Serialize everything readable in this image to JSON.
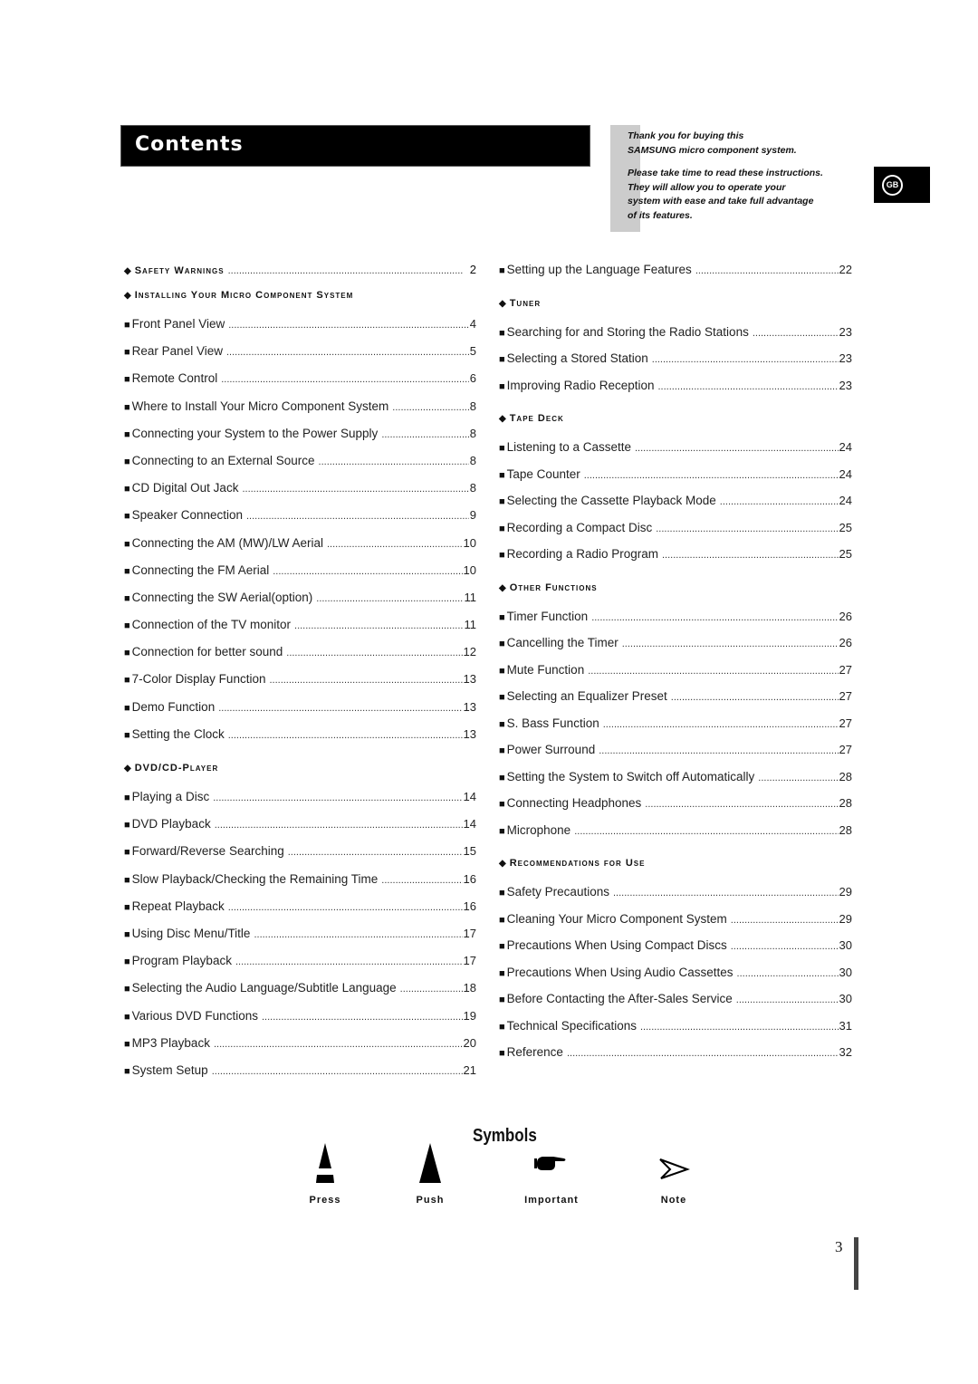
{
  "header": {
    "title": "Contents",
    "intro_line1": "Thank you for buying this",
    "intro_line2": "SAMSUNG micro component system.",
    "intro_line3": "Please take time to read these instructions.",
    "intro_line4": "They will allow you to operate your",
    "intro_line5": "system with ease and take full advantage",
    "intro_line6": "of its features.",
    "language_badge": "GB"
  },
  "toc_left": [
    {
      "type": "section",
      "label": "Safety Warnings",
      "page": "2"
    },
    {
      "type": "section",
      "label": "Installing Your Micro Component System"
    },
    {
      "type": "item",
      "label": "Front Panel View",
      "page": "4"
    },
    {
      "type": "item",
      "label": "Rear Panel View",
      "page": "5"
    },
    {
      "type": "item",
      "label": "Remote Control",
      "page": "6"
    },
    {
      "type": "item",
      "label": "Where to Install Your Micro Component System",
      "page": "8"
    },
    {
      "type": "item",
      "label": "Connecting your System to the Power Supply",
      "page": "8"
    },
    {
      "type": "item",
      "label": "Connecting to an External Source",
      "page": "8"
    },
    {
      "type": "item",
      "label": "CD Digital Out Jack",
      "page": "8"
    },
    {
      "type": "item",
      "label": "Speaker Connection",
      "page": "9"
    },
    {
      "type": "item",
      "label": "Connecting the AM (MW)/LW Aerial",
      "page": "10"
    },
    {
      "type": "item",
      "label": "Connecting the FM Aerial",
      "page": "10"
    },
    {
      "type": "item",
      "label": "Connecting the SW Aerial(option)",
      "page": "11"
    },
    {
      "type": "item",
      "label": "Connection of the TV monitor",
      "page": "11"
    },
    {
      "type": "item",
      "label": "Connection for better sound",
      "page": "12"
    },
    {
      "type": "item",
      "label": "7-Color Display Function",
      "page": "13"
    },
    {
      "type": "item",
      "label": "Demo Function",
      "page": "13"
    },
    {
      "type": "item",
      "label": "Setting the Clock",
      "page": "13"
    },
    {
      "type": "section",
      "label": "DVD/CD-Player",
      "spaced": true
    },
    {
      "type": "item",
      "label": "Playing a Disc",
      "page": "14"
    },
    {
      "type": "item",
      "label": "DVD Playback",
      "page": "14"
    },
    {
      "type": "item",
      "label": "Forward/Reverse Searching",
      "page": "15"
    },
    {
      "type": "item",
      "label": "Slow Playback/Checking the Remaining Time",
      "page": "16"
    },
    {
      "type": "item",
      "label": "Repeat Playback",
      "page": "16"
    },
    {
      "type": "item",
      "label": "Using Disc Menu/Title",
      "page": "17"
    },
    {
      "type": "item",
      "label": "Program Playback",
      "page": "17"
    },
    {
      "type": "item",
      "label": "Selecting the Audio Language/Subtitle Language",
      "page": "18"
    },
    {
      "type": "item",
      "label": "Various DVD Functions",
      "page": "19"
    },
    {
      "type": "item",
      "label": "MP3 Playback",
      "page": "20"
    },
    {
      "type": "item",
      "label": "System Setup",
      "page": "21"
    }
  ],
  "toc_right": [
    {
      "type": "item",
      "label": "Setting up the Language Features",
      "page": "22"
    },
    {
      "type": "section",
      "label": "Tuner",
      "spaced": true
    },
    {
      "type": "item",
      "label": "Searching for and Storing the Radio Stations",
      "page": "23"
    },
    {
      "type": "item",
      "label": "Selecting a Stored Station",
      "page": "23"
    },
    {
      "type": "item",
      "label": "Improving Radio Reception",
      "page": "23"
    },
    {
      "type": "section",
      "label": "Tape Deck",
      "spaced": true
    },
    {
      "type": "item",
      "label": "Listening to a Cassette",
      "page": "24"
    },
    {
      "type": "item",
      "label": "Tape Counter",
      "page": "24"
    },
    {
      "type": "item",
      "label": "Selecting the Cassette Playback Mode",
      "page": "24"
    },
    {
      "type": "item",
      "label": "Recording a Compact Disc",
      "page": "25"
    },
    {
      "type": "item",
      "label": "Recording a Radio Program",
      "page": "25"
    },
    {
      "type": "section",
      "label": "Other Functions",
      "spaced": true
    },
    {
      "type": "item",
      "label": "Timer Function",
      "page": "26"
    },
    {
      "type": "item",
      "label": "Cancelling the Timer",
      "page": "26"
    },
    {
      "type": "item",
      "label": "Mute Function",
      "page": "27"
    },
    {
      "type": "item",
      "label": "Selecting an Equalizer Preset",
      "page": "27"
    },
    {
      "type": "item",
      "label": "S. Bass Function",
      "page": "27"
    },
    {
      "type": "item",
      "label": "Power Surround",
      "page": "27"
    },
    {
      "type": "item",
      "label": "Setting the System to Switch off Automatically",
      "page": "28"
    },
    {
      "type": "item",
      "label": "Connecting Headphones",
      "page": "28"
    },
    {
      "type": "item",
      "label": "Microphone",
      "page": "28"
    },
    {
      "type": "section",
      "label": "Recommendations for Use",
      "spaced": true
    },
    {
      "type": "item",
      "label": "Safety Precautions",
      "page": "29"
    },
    {
      "type": "item",
      "label": "Cleaning Your Micro Component System",
      "page": "29"
    },
    {
      "type": "item",
      "label": "Precautions When Using Compact Discs",
      "page": "30"
    },
    {
      "type": "item",
      "label": "Precautions When Using Audio Cassettes",
      "page": "30"
    },
    {
      "type": "item",
      "label": "Before Contacting the After-Sales Service",
      "page": "30"
    },
    {
      "type": "item",
      "label": "Technical Specifications",
      "page": "31"
    },
    {
      "type": "item",
      "label": "Reference",
      "page": "32"
    }
  ],
  "symbols": {
    "title": "Symbols",
    "items": [
      {
        "icon": "press-icon",
        "label": "Press"
      },
      {
        "icon": "push-icon",
        "label": "Push"
      },
      {
        "icon": "pointing-hand-icon",
        "label": "Important"
      },
      {
        "icon": "arrow-note-icon",
        "label": "Note"
      }
    ]
  },
  "footer": {
    "page_number": "3"
  }
}
